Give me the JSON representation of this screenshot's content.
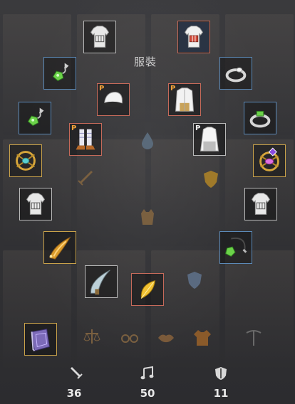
{
  "title": "服裝",
  "badges": {
    "premium": "P"
  },
  "stats": {
    "attack": "36",
    "music": "50",
    "defense": "11"
  },
  "colors": {
    "border_gray": "#b9b9b9",
    "border_blue": "#5c8ab8",
    "border_gold": "#c9a24a",
    "border_red": "#c66a5a",
    "badge_orange": "#f0a23a"
  },
  "icons": {
    "slots": [
      "costume-armor-icon",
      "costume-armor-icon",
      "green-gem-earring-icon",
      "silver-ring-icon",
      "white-hat-icon",
      "white-coat-icon",
      "green-gem-necklace-icon",
      "silver-ring-icon",
      "striped-boots-icon",
      "white-coat-icon",
      "gold-amulet-icon",
      "purple-gem-amulet-icon",
      "costume-armor-icon",
      "costume-armor-icon",
      "gold-horn-dagger-icon",
      "green-gem-bracelet-icon",
      "curved-blade-icon",
      "golden-feather-icon",
      "purple-book-icon"
    ],
    "ghost": [
      "water-drop-icon",
      "sword-icon",
      "shield-icon",
      "vest-icon",
      "shield-icon",
      "scale-icon",
      "glasses-icon",
      "lips-icon",
      "jacket-icon",
      "pickaxe-icon"
    ]
  }
}
